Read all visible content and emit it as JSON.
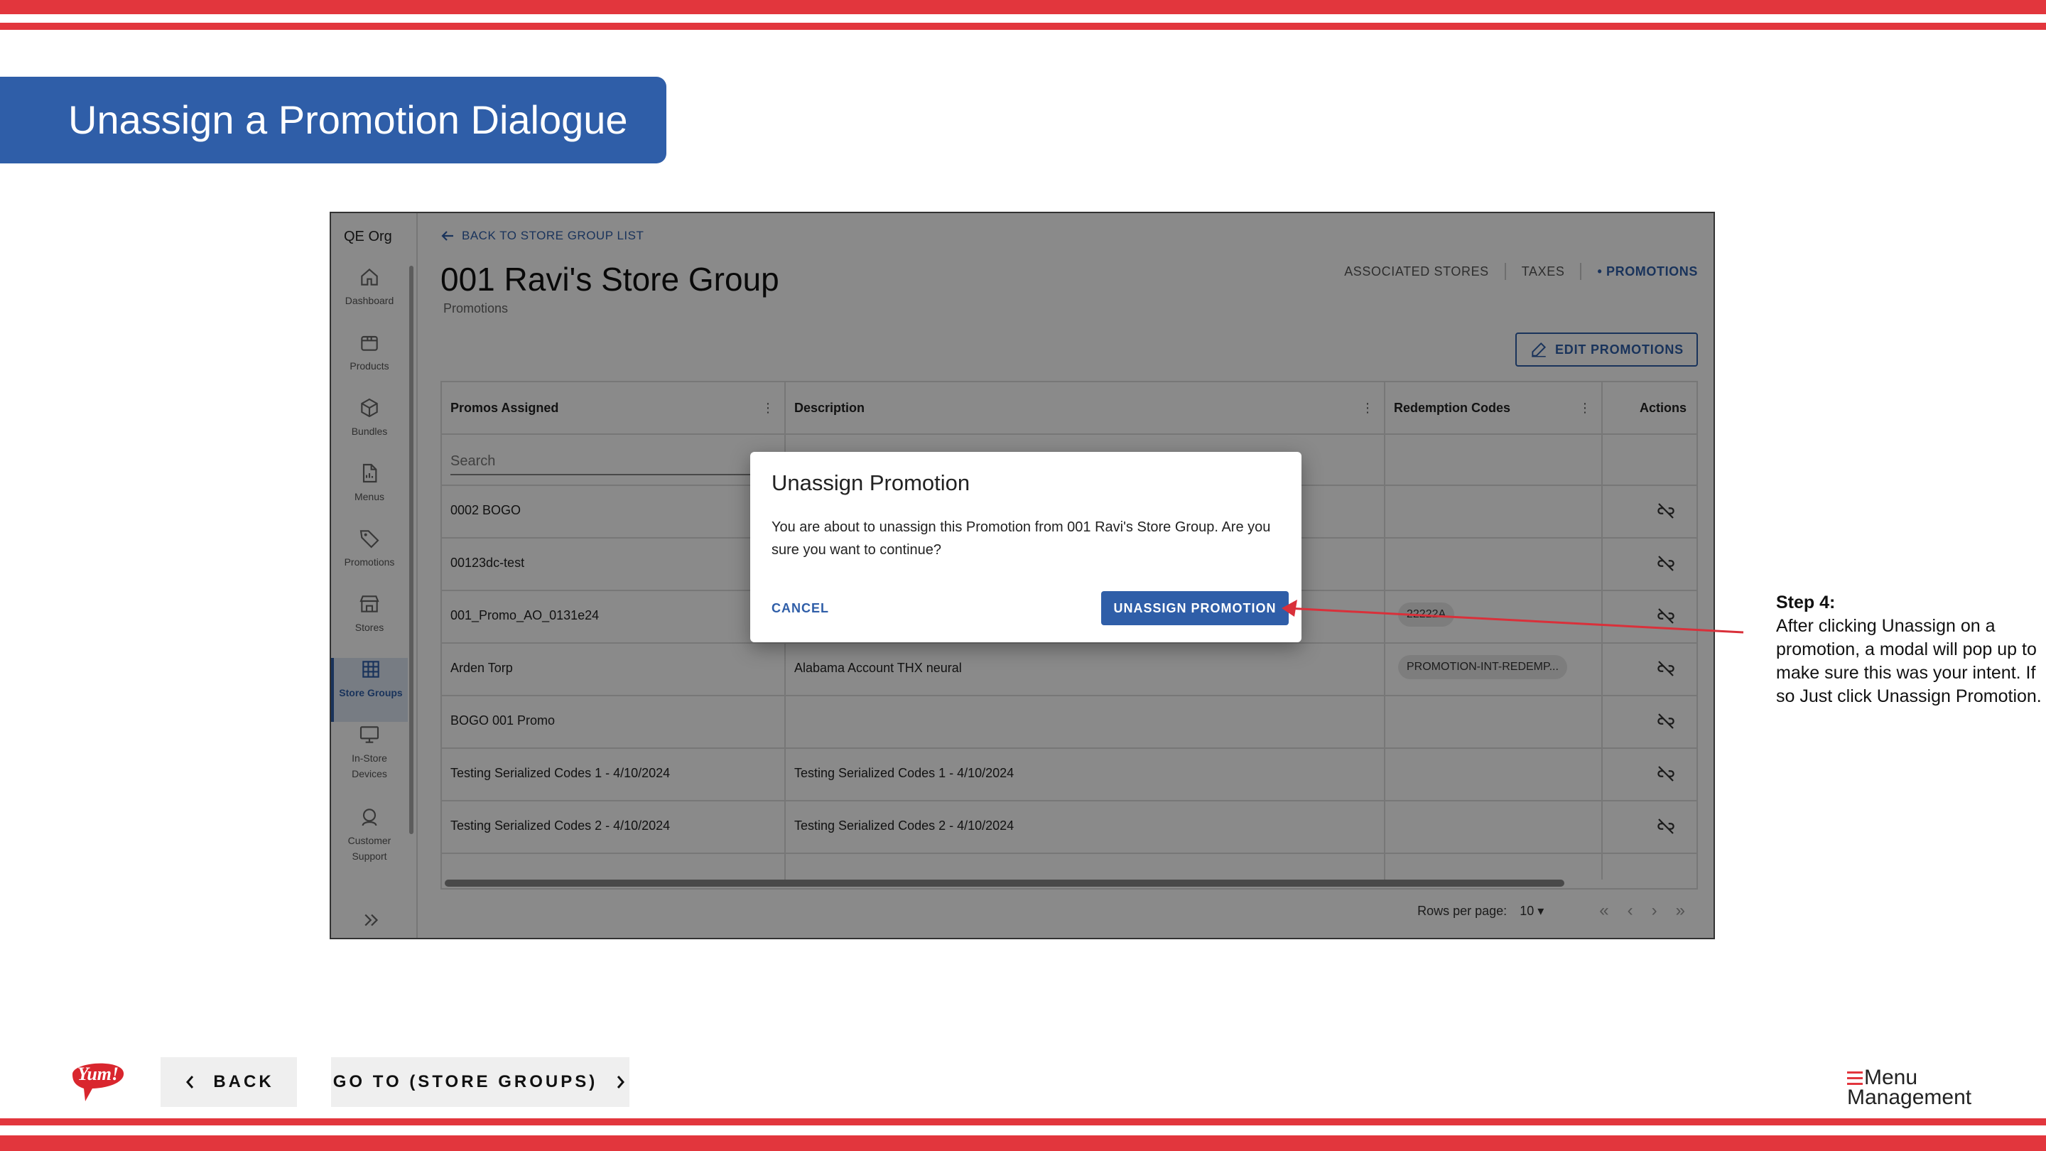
{
  "slide": {
    "title": "Unassign a Promotion Dialogue",
    "colors": {
      "accent_red": "#e2363d",
      "brand_blue": "#2f5ea8"
    }
  },
  "app": {
    "org_name": "QE Org",
    "nav": [
      {
        "label": "Dashboard",
        "icon": "home-icon"
      },
      {
        "label": "Products",
        "icon": "box-icon"
      },
      {
        "label": "Bundles",
        "icon": "cube-icon"
      },
      {
        "label": "Menus",
        "icon": "document-icon"
      },
      {
        "label": "Promotions",
        "icon": "tag-icon"
      },
      {
        "label": "Stores",
        "icon": "storefront-icon"
      },
      {
        "label": "Store Groups",
        "icon": "grid-icon",
        "active": true
      },
      {
        "label": "In-Store Devices",
        "icon": "monitor-icon"
      },
      {
        "label": "Customer Support",
        "icon": "headset-icon"
      }
    ],
    "back_link": "BACK TO STORE GROUP LIST",
    "page_title": "001 Ravi's Store Group",
    "page_subtitle": "Promotions",
    "tabs": [
      "ASSOCIATED STORES",
      "TAXES",
      "PROMOTIONS"
    ],
    "active_tab": "PROMOTIONS",
    "edit_button": "EDIT PROMOTIONS",
    "table": {
      "columns": [
        "Promos Assigned",
        "Description",
        "Redemption Codes",
        "Actions"
      ],
      "search_placeholder": "Search",
      "rows": [
        {
          "promo": "0002 BOGO",
          "description": "",
          "code": ""
        },
        {
          "promo": "00123dc-test",
          "description": "",
          "code": ""
        },
        {
          "promo": "001_Promo_AO_0131e24",
          "description": "",
          "code": "22222A"
        },
        {
          "promo": "Arden Torp",
          "description": "Alabama Account THX neural",
          "code": "PROMOTION-INT-REDEMP..."
        },
        {
          "promo": "BOGO 001 Promo",
          "description": "",
          "code": ""
        },
        {
          "promo": "Testing Serialized Codes 1 - 4/10/2024",
          "description": "Testing Serialized Codes 1 - 4/10/2024",
          "code": ""
        },
        {
          "promo": "Testing Serialized Codes 2 - 4/10/2024",
          "description": "Testing Serialized Codes 2 - 4/10/2024",
          "code": ""
        }
      ]
    },
    "pager": {
      "rows_label": "Rows per page:",
      "rows_value": "10"
    }
  },
  "modal": {
    "title": "Unassign Promotion",
    "body": "You are about to unassign this Promotion from 001 Ravi's Store Group. Are you sure you want to continue?",
    "cancel": "CANCEL",
    "confirm": "UNASSIGN PROMOTION"
  },
  "annotation": {
    "title": "Step 4:",
    "text": "After clicking Unassign on a promotion, a modal will pop up to make sure this was your intent. If so Just click Unassign Promotion."
  },
  "footer": {
    "back": "BACK",
    "next": "GO TO (STORE GROUPS)",
    "yum_logo": "Yum!",
    "brand_line1": "Menu",
    "brand_line2": "Management"
  }
}
